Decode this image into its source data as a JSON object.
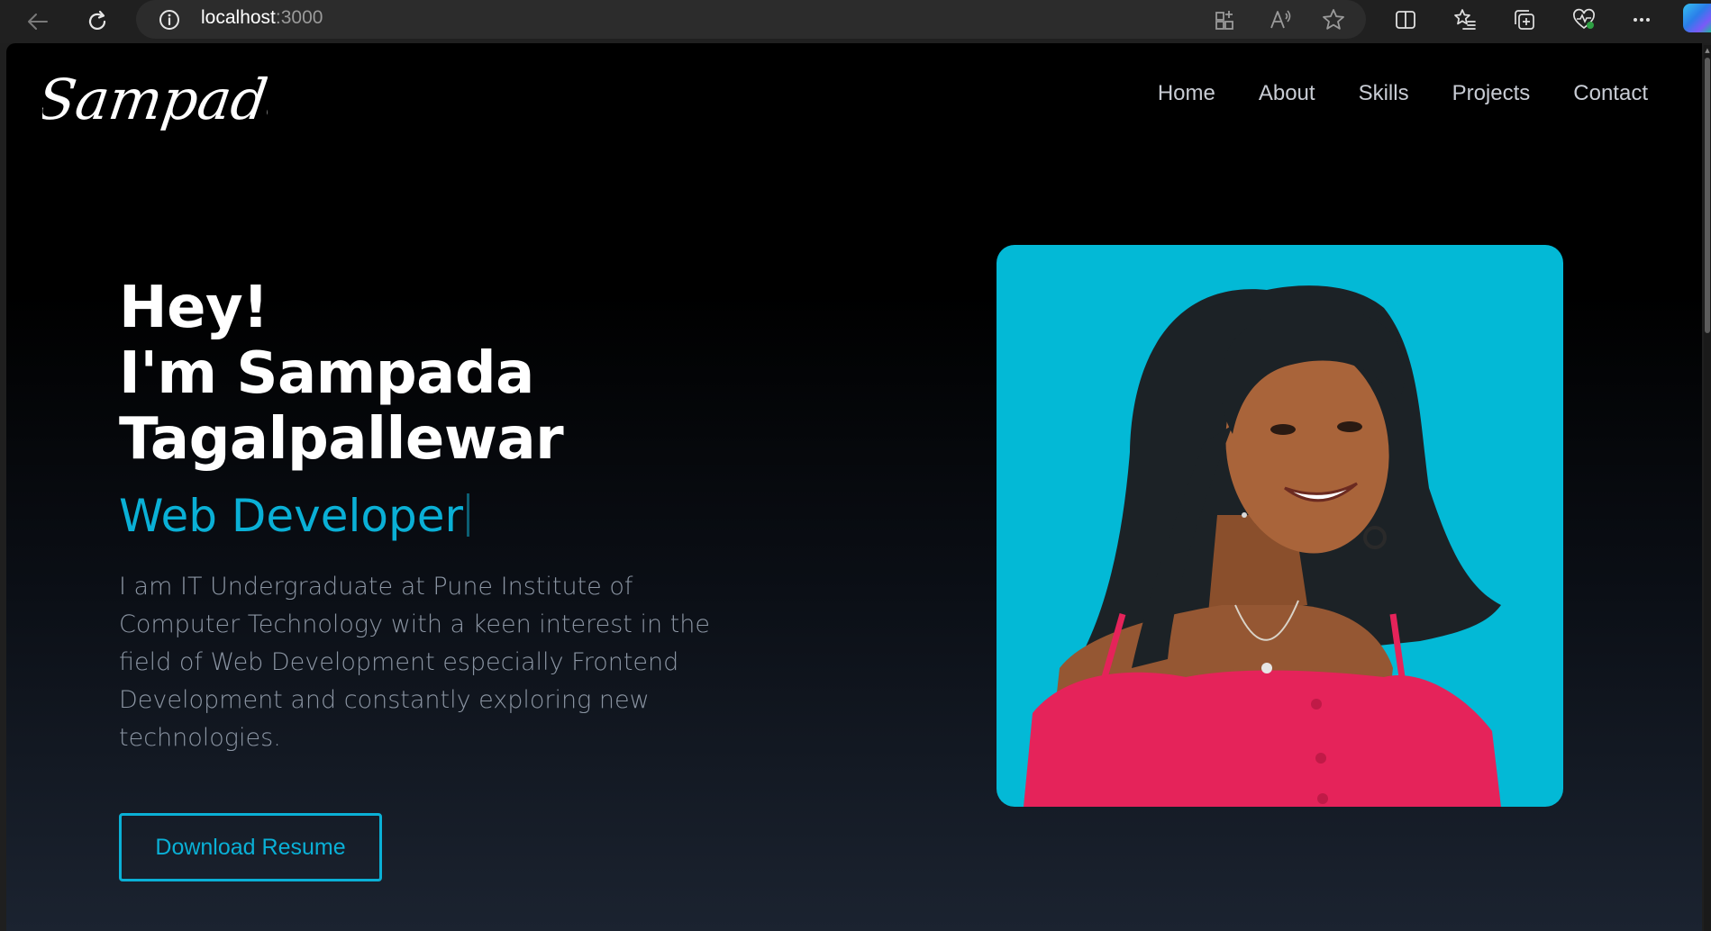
{
  "browser": {
    "url_host": "localhost",
    "url_port": ":3000"
  },
  "site": {
    "logo_text": "Sampada",
    "nav": [
      "Home",
      "About",
      "Skills",
      "Projects",
      "Contact"
    ]
  },
  "hero": {
    "greeting": "Hey!",
    "name_line1": "I'm Sampada",
    "name_line2": "Tagalpallewar",
    "role": "Web Developer",
    "description": "I am IT Undergraduate at Pune Institute of Computer Technology with a keen interest in the field of Web Development especially Frontend Development and constantly exploring new technologies.",
    "button_label": "Download Resume"
  },
  "colors": {
    "accent": "#0ab0d6",
    "photo_bg": "#03b9d6",
    "top_dress": "#e5235a"
  }
}
